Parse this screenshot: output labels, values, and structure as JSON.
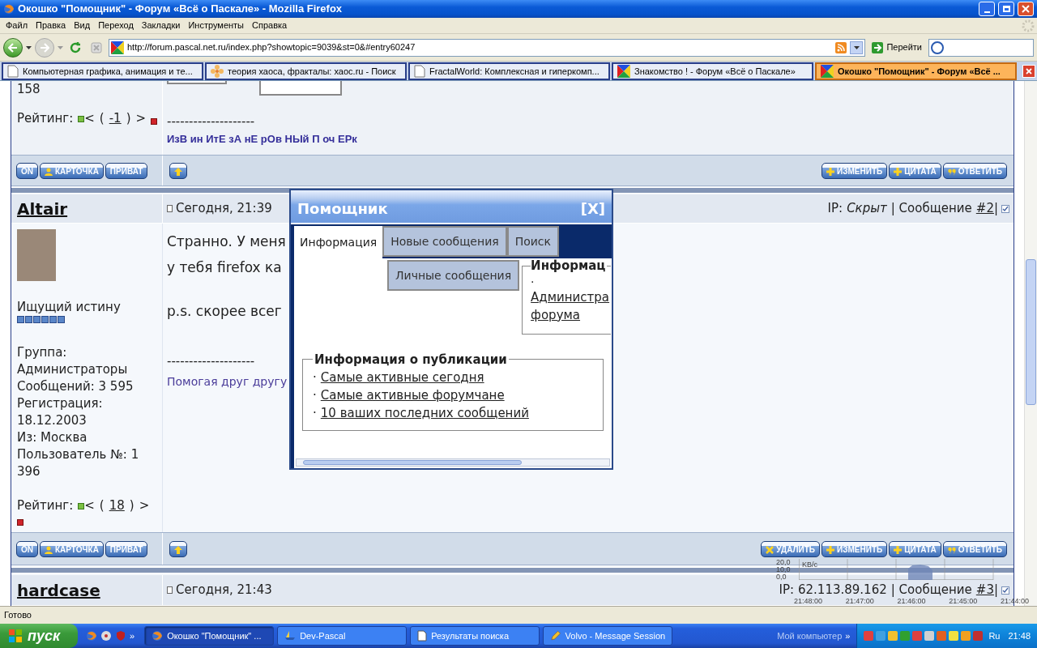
{
  "window": {
    "title": "Окошко \"Помощник\" - Форум «Всё о Паскале» - Mozilla Firefox"
  },
  "menu": [
    "Файл",
    "Правка",
    "Вид",
    "Переход",
    "Закладки",
    "Инструменты",
    "Справка"
  ],
  "address": {
    "url": "http://forum.pascal.net.ru/index.php?showtopic=9039&st=0&#entry60247",
    "go": "Перейти"
  },
  "tabs": [
    {
      "label": "Компьютерная графика, анимация и те...",
      "selected": false,
      "kind": "page"
    },
    {
      "label": "теория хаоса, фракталы: хаос.ru - Поиск",
      "selected": false,
      "kind": "flower"
    },
    {
      "label": "FractalWorld: Комплексная и гиперкомп...",
      "selected": false,
      "kind": "page"
    },
    {
      "label": "Знакомство ! - Форум «Всё о Паскале»",
      "selected": false,
      "kind": "forum"
    },
    {
      "label": "Окошко \"Помощник\" - Форум «Всё ...",
      "selected": true,
      "kind": "forum"
    }
  ],
  "post_tail": {
    "stat": "158",
    "rating": {
      "label": "Рейтинг:",
      "less": "<",
      "open": "(",
      "value": "-1",
      "close": ")",
      "more": ">"
    },
    "separator": "--------------------",
    "signature": "ИзВ ин ИтЕ зА нЕ рОв НЫй П оч ЕРк",
    "buttons_left": [
      {
        "label": "ON",
        "kind": "online"
      },
      {
        "label": "КАРТОЧКА",
        "kind": "profile"
      },
      {
        "label": "ПРИВАТ",
        "kind": "private"
      }
    ],
    "buttons_right": [
      {
        "label": "ИЗМЕНИТЬ",
        "kind": "edit"
      },
      {
        "label": "ЦИТАТА",
        "kind": "quote"
      },
      {
        "label": "ОТВЕТИТЬ",
        "kind": "reply"
      }
    ]
  },
  "post": {
    "author": "Altair",
    "date": "Сегодня, 21:39",
    "ip_label": "IP:",
    "ip": "Скрыт",
    "ip_hidden": true,
    "message_label": "| Сообщение",
    "number": "#2",
    "bar": "|",
    "checked": true,
    "title": "Ищущий истину",
    "info": [
      "Группа:",
      "Администраторы",
      "Сообщений: 3 595",
      "Регистрация:",
      "18.12.2003",
      "Из: Москва",
      "Пользователь №: 1",
      "396"
    ],
    "rating": {
      "label": "Рейтинг:",
      "less": "<",
      "open": "(",
      "value": "18",
      "close": ")",
      "more": ">"
    },
    "body": [
      [
        "Странно. У меня",
        "у тебя firefox ка"
      ],
      [
        "p.s. скорее всег"
      ]
    ],
    "separator": "--------------------",
    "signature": "Помогая друг другу",
    "buttons_left": [
      {
        "label": "ON",
        "kind": "online"
      },
      {
        "label": "КАРТОЧКА",
        "kind": "profile"
      },
      {
        "label": "ПРИВАТ",
        "kind": "private"
      }
    ],
    "buttons_right": [
      {
        "label": "УДАЛИТЬ",
        "kind": "delete"
      },
      {
        "label": "ИЗМЕНИТЬ",
        "kind": "edit"
      },
      {
        "label": "ЦИТАТА",
        "kind": "quote"
      },
      {
        "label": "ОТВЕТИТЬ",
        "kind": "reply"
      }
    ]
  },
  "next_post": {
    "author": "hardcase",
    "date": "Сегодня, 21:43",
    "ip_label": "IP:",
    "ip": "62.113.89.162",
    "ip_hidden": false,
    "message_label": "| Сообщение",
    "number": "#3",
    "bar": "|",
    "checked": true
  },
  "popup": {
    "title": "Помощник",
    "close": "[X]",
    "tabs": [
      {
        "label": "Информация",
        "selected": true
      },
      {
        "label": "Новые сообщения",
        "selected": false
      },
      {
        "label": "Поиск",
        "selected": false
      },
      {
        "label": "Личные сообщения",
        "selected": false
      }
    ],
    "side_box": {
      "legend": "Информац",
      "bullet": "·",
      "link_lines": [
        "Администра",
        "форума"
      ]
    },
    "publication": {
      "legend": "Информация о публикации",
      "links": [
        {
          "bullet": "·",
          "label": "Самые активные сегодня"
        },
        {
          "bullet": "·",
          "label": "Самые активные форумчане"
        },
        {
          "bullet": "·",
          "label": "10 ваших последних сообщений"
        }
      ]
    }
  },
  "traffic_meter": {
    "y_labels": [
      "20,0",
      "10,0",
      "0,0"
    ],
    "unit": "KB/c",
    "x_labels": [
      "21:48:00",
      "21:47:00",
      "21:46:00",
      "21:45:00",
      "21:44:00"
    ]
  },
  "status_bar": "Готово",
  "taskbar": {
    "start": "пуск",
    "more": "»",
    "tasks": [
      {
        "label": "Окошко \"Помощник\" ...",
        "selected": true,
        "kind": "firefox"
      },
      {
        "label": "Dev-Pascal",
        "selected": false,
        "kind": "ide"
      },
      {
        "label": "Результаты поиска",
        "selected": false,
        "kind": "page"
      },
      {
        "label": "Volvo - Message Session",
        "selected": false,
        "kind": "chat"
      }
    ],
    "toolbar": "Мой компьютер",
    "toolbar_more": "»",
    "lang": "Ru",
    "clock": "21:48"
  }
}
